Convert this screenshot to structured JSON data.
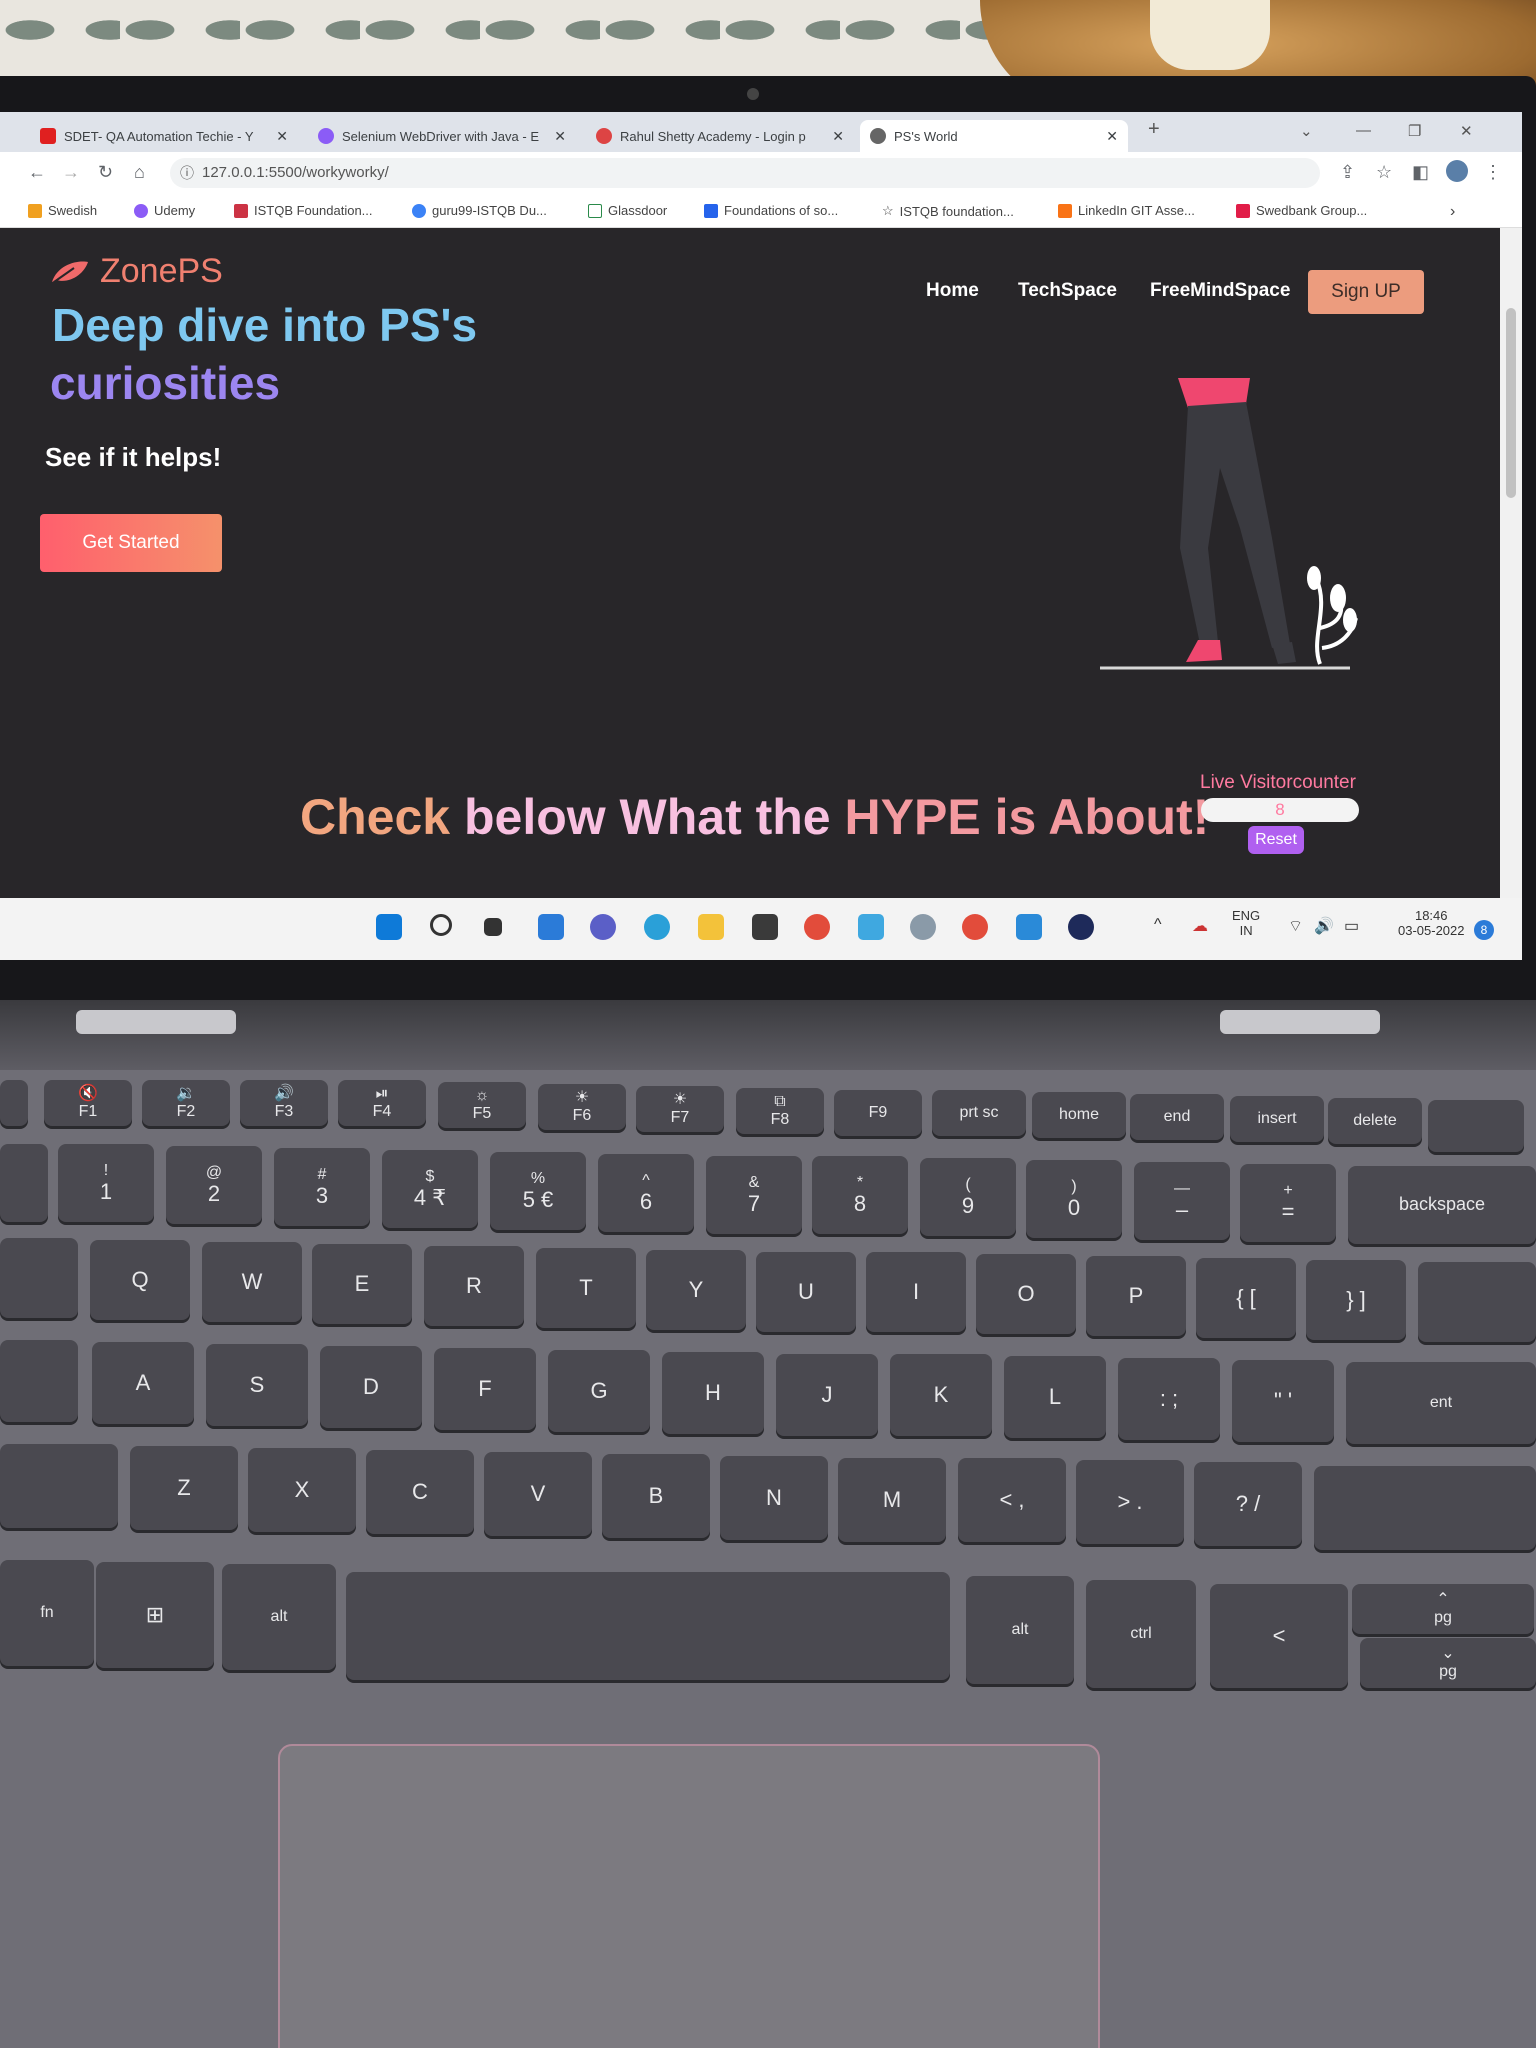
{
  "browser": {
    "tabs": [
      {
        "title": "SDET- QA Automation Techie - Y",
        "favicon_color": "#e02020"
      },
      {
        "title": "Selenium WebDriver with Java - E",
        "favicon_color": "#8b5cf6"
      },
      {
        "title": "Rahul Shetty Academy - Login p",
        "favicon_color": "#d33"
      },
      {
        "title": "PS's World",
        "favicon_color": "#555"
      }
    ],
    "new_tab": "+",
    "address": "127.0.0.1:5500/workyworky/",
    "bookmarks": [
      "Swedish",
      "Udemy",
      "ISTQB Foundation...",
      "guru99-ISTQB Du...",
      "Glassdoor",
      "Foundations of so...",
      "ISTQB foundation...",
      "LinkedIn GIT Asse...",
      "Swedbank Group..."
    ]
  },
  "site": {
    "logo": "ZonePS",
    "nav": [
      "Home",
      "TechSpace",
      "FreeMindSpace"
    ],
    "signup": "Sign UP",
    "hero_line1": "Deep dive into PS's",
    "hero_line2": "curiosities",
    "hero_sub": "See if it helps!",
    "cta": "Get Started",
    "hype_part1": "Check ",
    "hype_part2": "below What the ",
    "hype_part3": "HYPE is About!",
    "counter_label": "Live Visitorcounter",
    "counter_value": "8",
    "reset": "Reset"
  },
  "taskbar": {
    "lang": "ENG",
    "region": "IN",
    "time": "18:46",
    "date": "03-05-2022",
    "notifications": "8"
  },
  "keyboard": {
    "fn_row": [
      "F1",
      "F2",
      "F3",
      "F4",
      "F5",
      "F6",
      "F7",
      "F8",
      "F9",
      "prt sc",
      "home",
      "end",
      "insert",
      "delete"
    ],
    "num_row": [
      [
        "!",
        "1"
      ],
      [
        "@",
        "2"
      ],
      [
        "#",
        "3"
      ],
      [
        "$",
        "4 ₹"
      ],
      [
        "%",
        "5 €"
      ],
      [
        "^",
        "6"
      ],
      [
        "&",
        "7"
      ],
      [
        "*",
        "8"
      ],
      [
        "(",
        "9"
      ],
      [
        ")",
        "0"
      ],
      [
        "—",
        "–"
      ],
      [
        "+",
        "="
      ]
    ],
    "backspace": "backspace",
    "row_q": [
      "Q",
      "W",
      "E",
      "R",
      "T",
      "Y",
      "U",
      "I",
      "O",
      "P",
      "{ [",
      "} ]"
    ],
    "row_a": [
      "A",
      "S",
      "D",
      "F",
      "G",
      "H",
      "J",
      "K",
      "L",
      ": ;",
      "\" '"
    ],
    "enter": "ent",
    "row_z": [
      "Z",
      "X",
      "C",
      "V",
      "B",
      "N",
      "M",
      "< ,",
      "> .",
      "? /"
    ],
    "fn": "fn",
    "alt": "alt",
    "ctrl": "ctrl",
    "left": "<",
    "pg": "pg"
  }
}
